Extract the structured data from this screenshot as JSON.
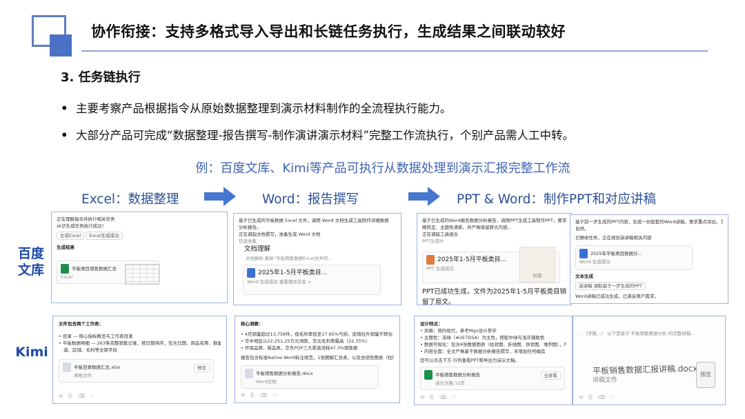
{
  "slide": {
    "title": "协作衔接：支持多格式导入导出和长链任务执行，生成结果之间联动较好",
    "section_heading": "3. 任务链执行",
    "bullets": [
      "主要考察产品根据指令从原始数据整理到演示材料制作的全流程执行能力。",
      "大部分产品可完成“数据整理-报告撰写-制作演讲演示材料”完整工作流执行，个别产品需人工中转。"
    ],
    "bullet_glyph": "•",
    "example_caption": "例：百度文库、Kimi等产品可执行从数据处理到演示汇报完整工作流",
    "stages": [
      "Excel：数据整理",
      "Word：报告撰写",
      "PPT & Word：制作PPT和对应讲稿"
    ],
    "rows": [
      "百度\n文库",
      "Kimi"
    ]
  },
  "colors": {
    "accent": "#4a72c4",
    "caption": "#3f63b3",
    "stage": "#2b4f95",
    "row_label": "#1e4aa8",
    "arrow": "#4577cf"
  },
  "baidu": {
    "excel": {
      "lines": [
        "正在理解指令并执行相关任务",
        "sk识生成任务执行成功！"
      ],
      "chips": [
        "生成Excel",
        "Excel生成成功"
      ],
      "result_label": "生成结果",
      "file_name": "平板类目销售数据汇总",
      "file_type": "Excel"
    },
    "word": {
      "lines": [
        "基于已生成的平板数据 Excel 文件，调用 Word 文档生成工具制作详细数据",
        "分析报告。",
        "正在调起文档撰写，准备生成 Word 文档",
        "信息收集"
      ],
      "panel_label": "文档理解",
      "panel_sub": "文档解析  解析\"平板销售数据Excel文件的...",
      "doc_title": "2025年1-5月平板类目...",
      "doc_meta": "Word 生成成功  查看相关信息 >"
    },
    "ppt": {
      "lines": [
        "基于已生成的Word报告数据分析报告，调用PPT生成工具制作PPT，要求",
        "精简呈、主题色清新，并严格保留原文内容。",
        "正在调起工具组合",
        "PPT生成中"
      ],
      "doc_title": "2025年1-5月平板类目...",
      "doc_meta": "PPT 生成成功",
      "done_text": "PPT已成功生成，文件为2025年1-5月平板类目销售数据分析报告，完整保",
      "done_text_2": "留了原文。",
      "thumb_label": "封面"
    },
    "script": {
      "lines": [
        "基于前一步生成的PPT内容，生成一份配套的Word讲稿，要求重点突出、言词",
        "自然。",
        "已确收任务，正在规划演讲稿相关内容"
      ],
      "doc_title": "2025年平板类目数据分...",
      "doc_meta": "Word 生成成功",
      "chip_label": "文本生成",
      "chip_sub": "演讲稿 调取基于一步生成的PPT",
      "done_text": "Word讲稿已成功生成，已满足用户需求。"
    }
  },
  "kimi": {
    "excel": {
      "heading": "文件包含两个工作表：",
      "items": [
        "目录 — 核心指标概览与工作表目录",
        "平板数据明细 — 263条完整销售记录，按日期排序，包含日期、商品名称、数量、销售额、渠",
        "道、区域、毛利等全部字段"
      ],
      "file_name": "平板目录数据汇总.xlsx",
      "file_meta": "表格文件",
      "btn": "预览"
    },
    "word": {
      "heading": "核心洞察：",
      "items": [
        "4月销量超过13,756件，但毛利率低至17.65%亏损，促销拉升销量不转化",
        "华中地区以22,251,25万元领跑，华北毛利率最高（22.35%）",
        "环保品牌，新品类，京东POP三大渠道消耗47.3%销售额"
      ],
      "note": "报告包含标准Native Word标注规范，1张图解汇总表，以及总结性图表（柱形/折线图）和见解（百科）。",
      "file_name": "平板销售数据分析报告.docx",
      "file_meta": "Word文档"
    },
    "ppt": {
      "heading": "设计特点：",
      "items": [
        "风格：简约现代，参考Mgo设计美学",
        "主题色：深绿（#2E7D5A）为主色，搭配中绿与浅灰辅助色",
        "数据可视化：包含6张数据图表（柱状图、折线图、饼状图、堆积图），严格保留数据完整性",
        "内容全面：全文严格基于数据分析报告撰写，未增加任何编造"
      ],
      "note": "您可以点击下方 行列查看PPT和导出为演示文稿。",
      "file_name": "平板销售数据分析报告",
      "file_meta": "演示文稿 12页",
      "btn": "全屏看"
    },
    "script": {
      "top_line": "…（字数…）  以下是基于 平板销售数据分析 的完整讲稿…",
      "file_name": "平板销售数据汇报讲稿.docx",
      "file_meta": "讲稿文件",
      "btn": "预览"
    }
  }
}
